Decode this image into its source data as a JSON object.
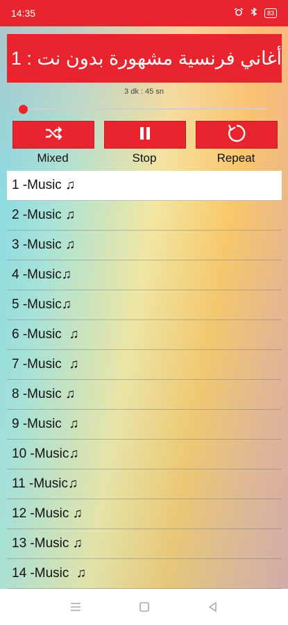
{
  "status_bar": {
    "time": "14:35",
    "battery": "83",
    "icons": [
      "alarm-icon",
      "bluetooth-icon",
      "battery-icon"
    ]
  },
  "player": {
    "title": "أغاني فرنسية مشهورة بدون نت : 1",
    "duration": "3 dk : 45 sn",
    "progress": 0.0
  },
  "controls": {
    "mixed_label": "Mixed",
    "stop_label": "Stop",
    "repeat_label": "Repeat"
  },
  "tracks": [
    "1 -Music ♫",
    "2 -Music ♫",
    "3 -Music ♫",
    "4 -Music♫",
    "5 -Music♫",
    "6 -Music  ♫",
    "7 -Music  ♫",
    "8 -Music ♫",
    "9 -Music  ♫",
    "10 -Music♫",
    "11 -Music♫",
    "12 -Music ♫",
    "13 -Music ♫",
    "14 -Music  ♫"
  ],
  "active_track_index": 0,
  "colors": {
    "accent": "#e8252f"
  },
  "nav": [
    "menu-icon",
    "home-icon",
    "back-icon"
  ]
}
